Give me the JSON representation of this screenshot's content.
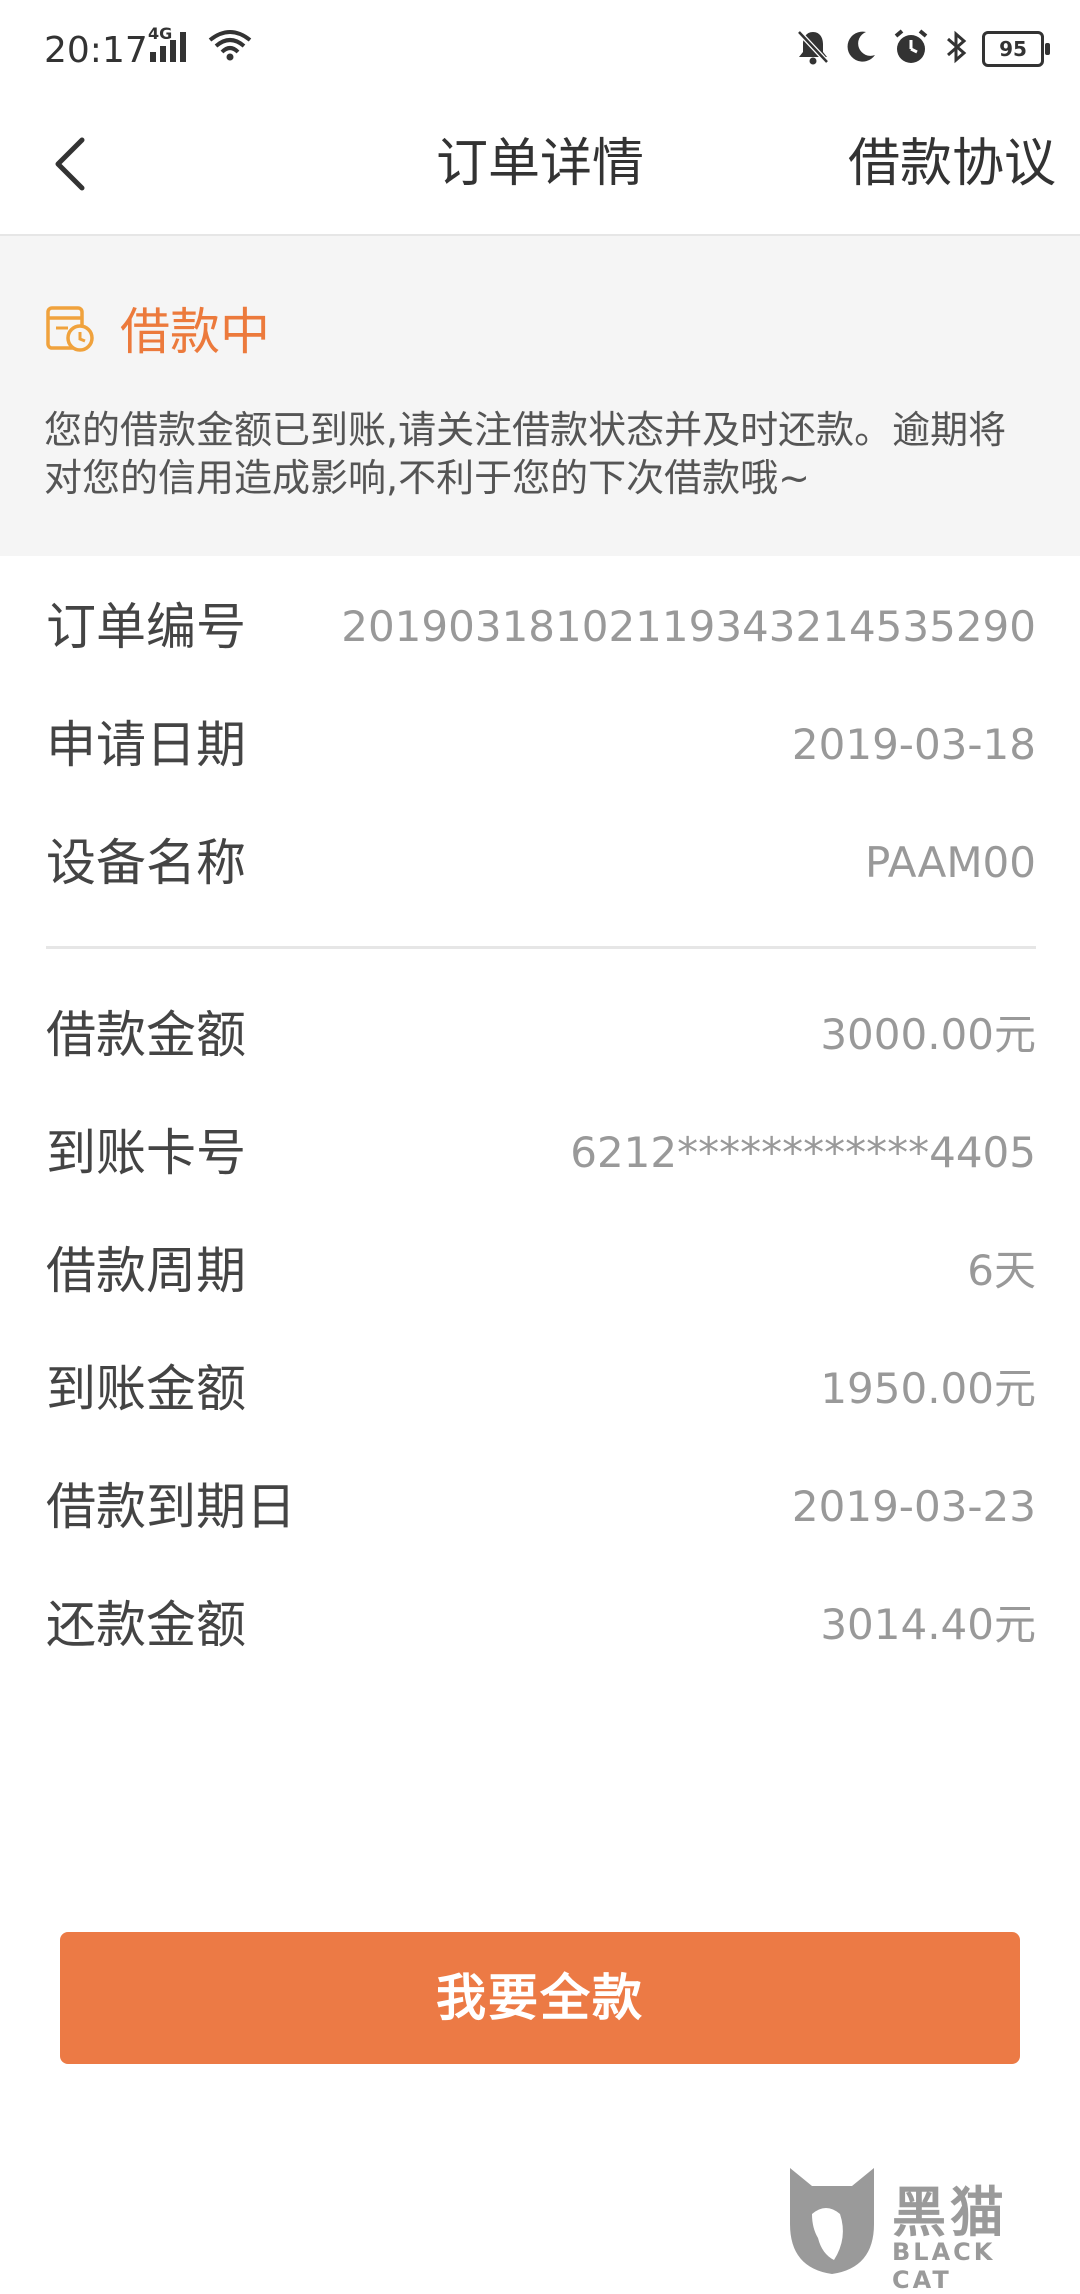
{
  "statusbar": {
    "time": "20:17",
    "network": "4G",
    "battery": "95"
  },
  "nav": {
    "title": "订单详情",
    "right_link": "借款协议"
  },
  "status": {
    "label": "借款中",
    "description": "您的借款金额已到账,请关注借款状态并及时还款。逾期将对您的信用造成影响,不利于您的下次借款哦~",
    "accent_color": "#ec7a3c"
  },
  "order_info": [
    {
      "label": "订单编号",
      "value": "20190318102119343214535290"
    },
    {
      "label": "申请日期",
      "value": "2019-03-18"
    },
    {
      "label": "设备名称",
      "value": "PAAM00"
    }
  ],
  "loan_info": [
    {
      "label": "借款金额",
      "value": "3000.00元"
    },
    {
      "label": "到账卡号",
      "value": "6212************4405"
    },
    {
      "label": "借款周期",
      "value": "6天"
    },
    {
      "label": "到账金额",
      "value": "1950.00元"
    },
    {
      "label": "借款到期日",
      "value": "2019-03-23"
    },
    {
      "label": "还款金额",
      "value": "3014.40元"
    }
  ],
  "action": {
    "button_label": "我要全款",
    "button_color": "#ec7a45"
  },
  "watermark": {
    "text": "黑猫",
    "sub": "BLACK CAT"
  },
  "icons": {
    "back": "chevron-left-icon",
    "status": "calendar-clock-icon"
  }
}
